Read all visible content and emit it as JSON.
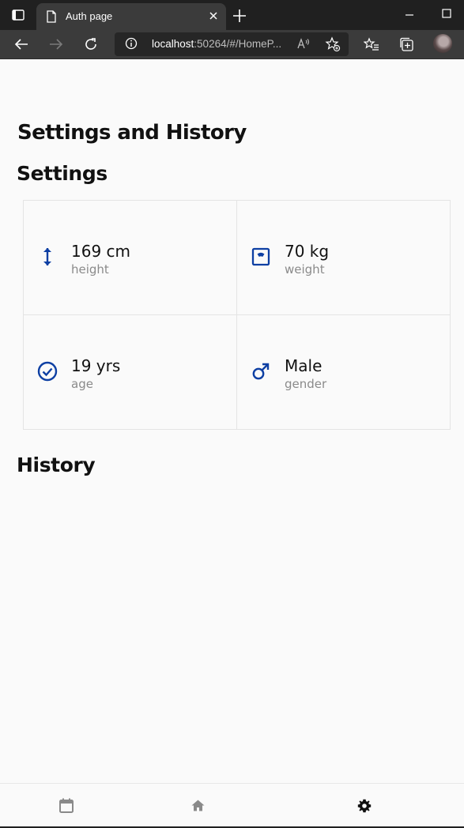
{
  "browser": {
    "tab_title": "Auth page",
    "address": {
      "host": "localhost",
      "rest": ":50264/#/HomeP..."
    }
  },
  "page": {
    "title": "Settings and History",
    "settings_heading": "Settings",
    "history_heading": "History"
  },
  "settings": [
    {
      "value": "169 cm",
      "label": "height",
      "icon": "height-arrows-icon"
    },
    {
      "value": "70 kg",
      "label": "weight",
      "icon": "scale-icon"
    },
    {
      "value": "19 yrs",
      "label": "age",
      "icon": "check-circle-icon"
    },
    {
      "value": "Male",
      "label": "gender",
      "icon": "male-icon"
    }
  ],
  "bottom_nav": [
    {
      "name": "calendar",
      "icon": "calendar-icon",
      "active": false
    },
    {
      "name": "home",
      "icon": "home-icon",
      "active": false
    },
    {
      "name": "settings",
      "icon": "gear-icon",
      "active": true
    }
  ],
  "colors": {
    "accent": "#0d3fa3",
    "inactive_nav": "#8a8a8a",
    "active_nav": "#111111"
  }
}
